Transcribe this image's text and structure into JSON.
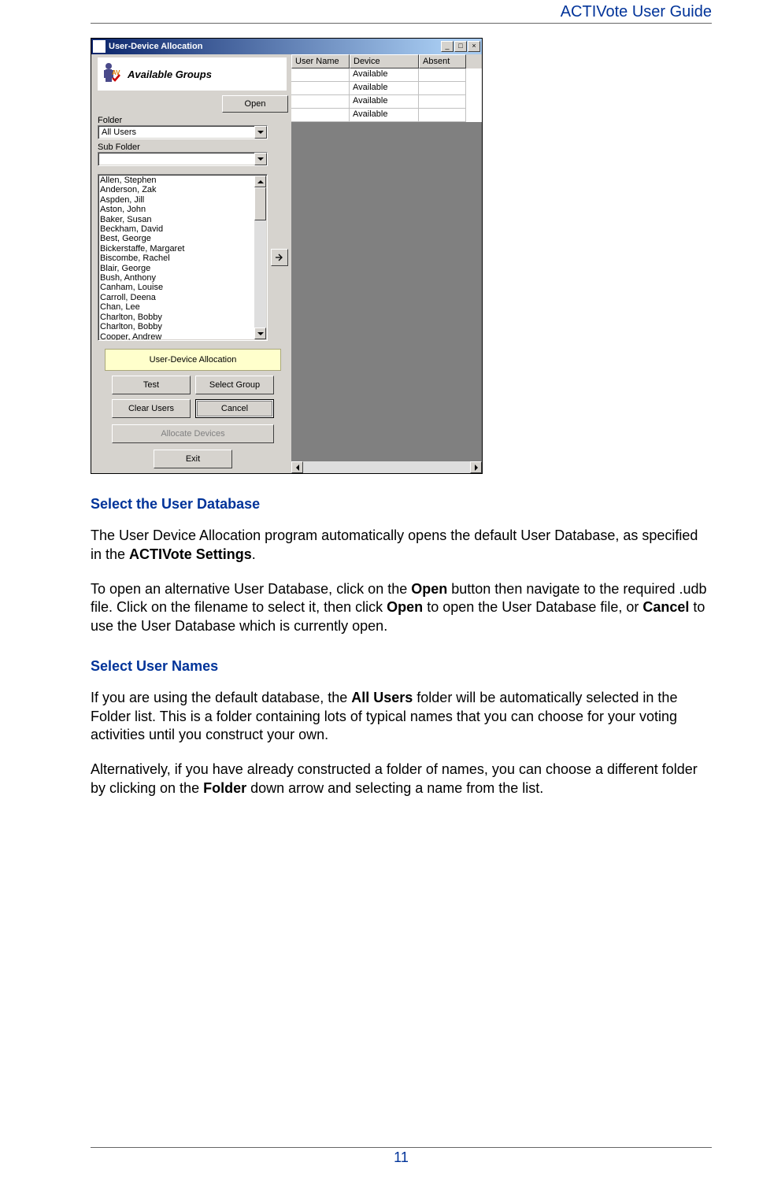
{
  "header": {
    "title": "ACTIVote User Guide"
  },
  "page_number": "11",
  "window": {
    "title": "User-Device Allocation",
    "groups_header": "Available Groups",
    "labels": {
      "folder": "Folder",
      "subfolder": "Sub Folder"
    },
    "folder_value": "All Users",
    "subfolder_value": "",
    "open_button": "Open",
    "users": [
      "Allen, Stephen",
      "Anderson, Zak",
      "Aspden, Jill",
      "Aston, John",
      "Baker, Susan",
      "Beckham, David",
      "Best, George",
      "Bickerstaffe, Margaret",
      "Biscombe, Rachel",
      "Blair, George",
      "Bush, Anthony",
      "Canham, Louise",
      "Carroll, Deena",
      "Chan, Lee",
      "Charlton, Bobby",
      "Charlton, Bobby",
      "Cooper, Andrew"
    ],
    "panel_label": "User-Device Allocation",
    "buttons": {
      "test": "Test",
      "select_group": "Select Group",
      "clear_users": "Clear Users",
      "cancel": "Cancel",
      "allocate": "Allocate Devices",
      "exit": "Exit"
    },
    "table": {
      "headers": {
        "c1": "User Name",
        "c2": "Device",
        "c3": "Absent"
      },
      "rows": [
        {
          "c1": "",
          "c2": "Available",
          "c3": ""
        },
        {
          "c1": "",
          "c2": "Available",
          "c3": ""
        },
        {
          "c1": "",
          "c2": "Available",
          "c3": ""
        },
        {
          "c1": "",
          "c2": "Available",
          "c3": ""
        }
      ]
    }
  },
  "sections": {
    "s1_title": "Select the User Database",
    "s1_p1_a": "The User Device Allocation program automatically opens the default User Database, as specified in the ",
    "s1_p1_b": "ACTIVote Settings",
    "s1_p1_c": ".",
    "s1_p2_a": "To open an alternative User Database, click on the ",
    "s1_p2_b": "Open",
    "s1_p2_c": " button then navigate to the required .udb file. Click on the filename to select it, then click ",
    "s1_p2_d": "Open",
    "s1_p2_e": " to open the User Database file, or ",
    "s1_p2_f": "Cancel",
    "s1_p2_g": " to use the User Database which is currently open.",
    "s2_title": "Select User Names",
    "s2_p1_a": "If you are using the default database, the ",
    "s2_p1_b": "All Users",
    "s2_p1_c": " folder will be automatically selected in the Folder list. This is a folder containing lots of typical names that you can choose for your voting activities until you construct your own.",
    "s2_p2_a": "Alternatively, if you have already constructed a folder of names, you can choose a different folder by clicking on the ",
    "s2_p2_b": "Folder",
    "s2_p2_c": " down arrow and selecting a name from the list."
  }
}
